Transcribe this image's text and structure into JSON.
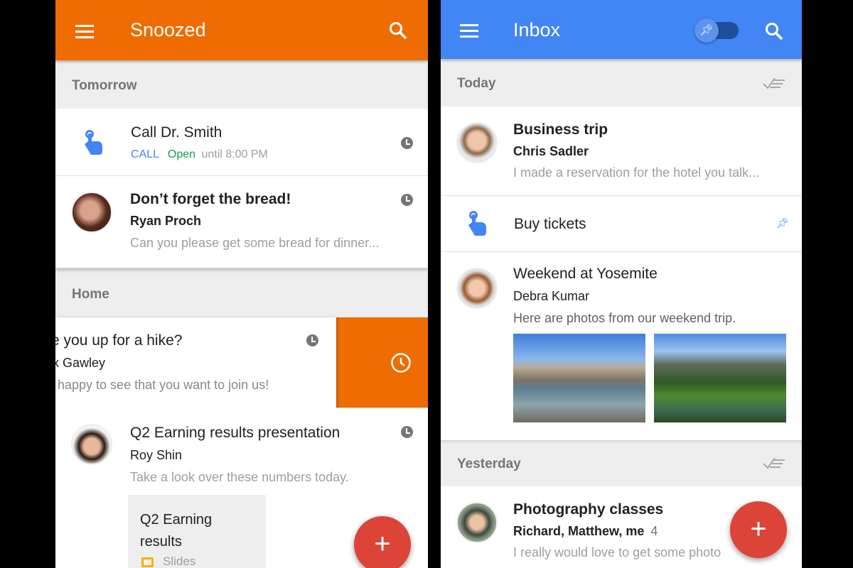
{
  "left": {
    "header": {
      "title": "Snoozed",
      "color": "#ef6c00"
    },
    "sections": [
      {
        "label": "Tomorrow"
      },
      {
        "label": "Home"
      }
    ],
    "items": [
      {
        "title": "Call Dr. Smith",
        "action": "CALL",
        "status": "Open",
        "detail": "until 8:00 PM",
        "icon": "reminder-hand-icon"
      },
      {
        "title": "Don’t forget the bread!",
        "sender": "Ryan Proch",
        "snippet": "Can you please get some bread for dinner..."
      },
      {
        "title": "e you up for a hike?",
        "sender": "x Gawley",
        "snippet": "happy to see that you want to join us!",
        "swipe_action_icon": "snooze-clock-icon"
      },
      {
        "title": "Q2 Earning results presentation",
        "sender": "Roy Shin",
        "snippet": "Take a look over these numbers today.",
        "attachment": {
          "title": "Q2 Earning results",
          "type": "Slides"
        }
      }
    ],
    "fab": "+"
  },
  "right": {
    "header": {
      "title": "Inbox",
      "color": "#4285f4",
      "pin_toggle": "pin-icon"
    },
    "sections": [
      {
        "label": "Today"
      },
      {
        "label": "Yesterday"
      }
    ],
    "items": [
      {
        "title": "Business trip",
        "sender": "Chris Sadler",
        "snippet": "I made a reservation for the hotel you talk..."
      },
      {
        "title": "Buy tickets",
        "icon": "reminder-hand-icon"
      },
      {
        "title": "Weekend at Yosemite",
        "sender": "Debra Kumar",
        "snippet": "Here are photos from our weekend trip."
      },
      {
        "title": "Photography classes",
        "sender": "Richard, Matthew, me",
        "count": "4",
        "snippet": "I really would love to get some photo"
      }
    ],
    "fab": "+"
  }
}
